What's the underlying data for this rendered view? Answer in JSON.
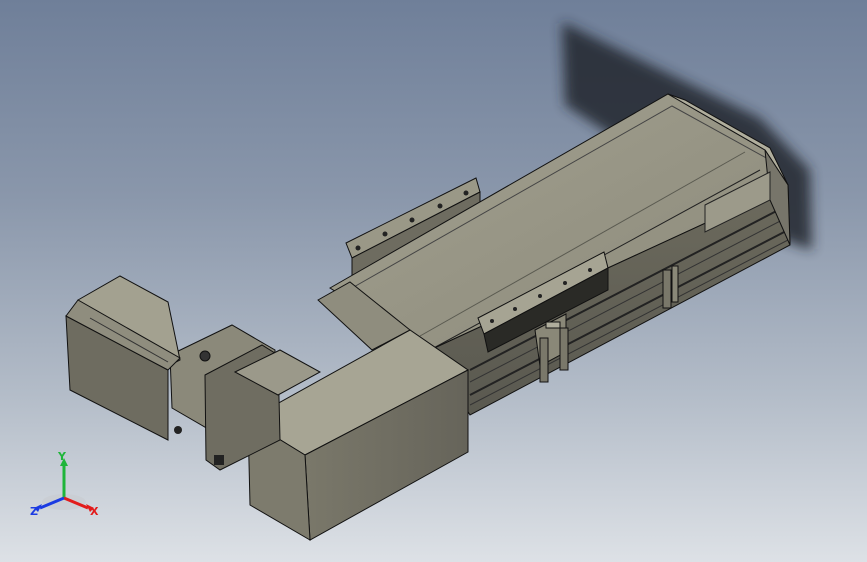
{
  "triad": {
    "x_label": "X",
    "y_label": "Y",
    "z_label": "Z",
    "x_color": "#e21b1b",
    "y_color": "#1fb53a",
    "z_color": "#1b3be2"
  },
  "model": {
    "body_color": "#8e8c7a",
    "edge_color": "#111111",
    "shadow_color": "#2a2f36"
  }
}
